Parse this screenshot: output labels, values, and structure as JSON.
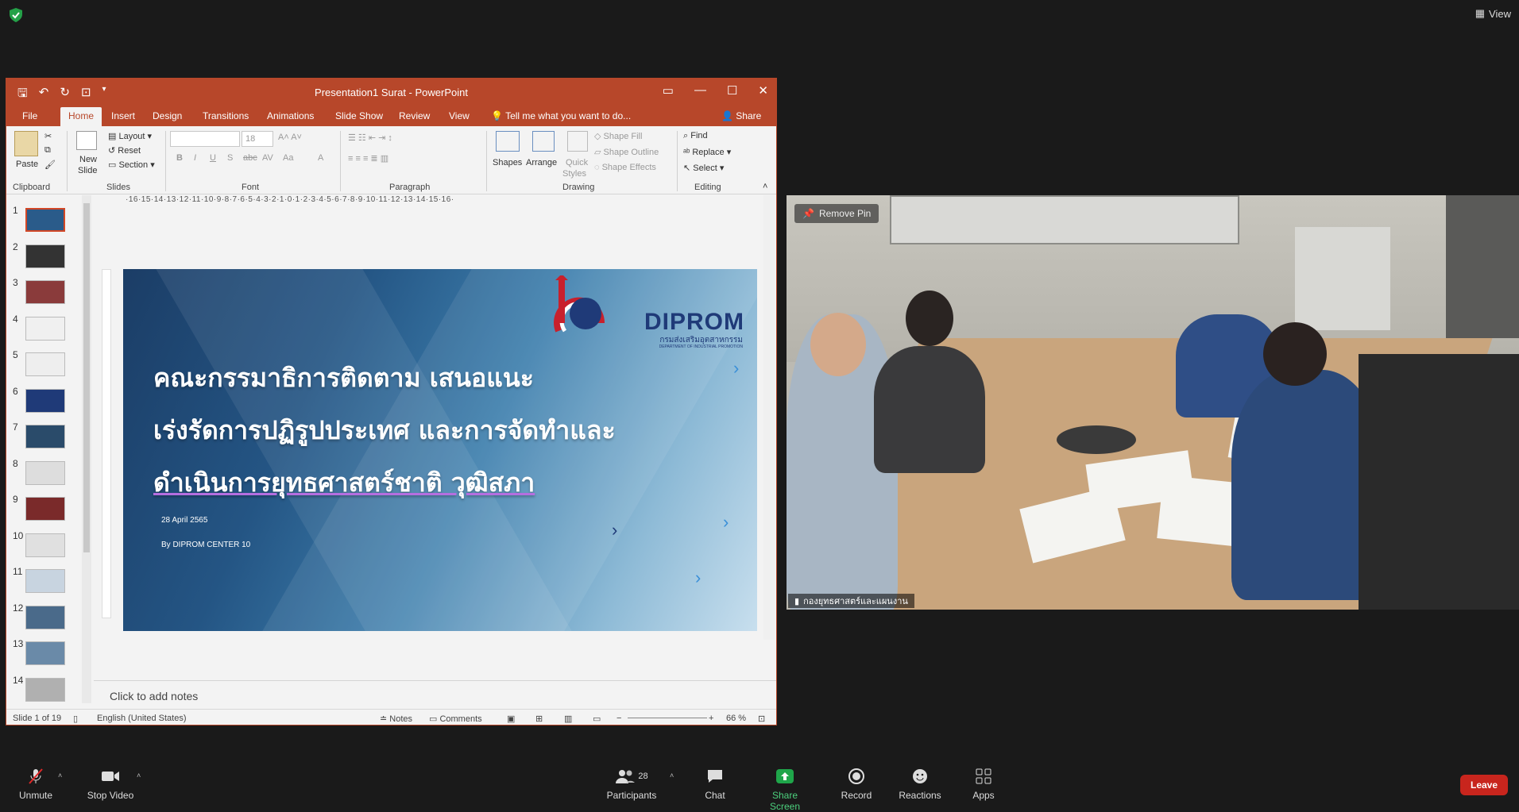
{
  "zoom": {
    "view_label": "View",
    "remove_pin_label": "Remove Pin",
    "participant_name": "กองยุทธศาสตร์และแผนงาน",
    "participants_count": "28",
    "toolbar": {
      "unmute": "Unmute",
      "stop_video": "Stop Video",
      "participants": "Participants",
      "chat": "Chat",
      "share_screen": "Share Screen",
      "record": "Record",
      "reactions": "Reactions",
      "apps": "Apps",
      "leave": "Leave"
    },
    "colors": {
      "share_green": "#1fa64a",
      "leave_red": "#c8251d"
    }
  },
  "ppt": {
    "title": "Presentation1 Surat - PowerPoint",
    "share": "Share",
    "tabs": [
      "File",
      "Home",
      "Insert",
      "Design",
      "Transitions",
      "Animations",
      "Slide Show",
      "Review",
      "View"
    ],
    "tell_me": "Tell me what you want to do...",
    "ribbon": {
      "paste": "Paste",
      "clipboard": "Clipboard",
      "new_slide": "New",
      "new_slide2": "Slide",
      "layout": "Layout",
      "reset": "Reset",
      "section": "Section",
      "slides": "Slides",
      "font_size": "18",
      "font": "Font",
      "paragraph": "Paragraph",
      "shapes": "Shapes",
      "arrange": "Arrange",
      "quick": "Quick",
      "styles": "Styles",
      "shape_fill": "Shape Fill",
      "shape_outline": "Shape Outline",
      "shape_effects": "Shape Effects",
      "drawing": "Drawing",
      "find": "Find",
      "replace": "Replace",
      "select": "Select",
      "editing": "Editing"
    },
    "ruler": "·16·15·14·13·12·11·10·9·8·7·6·5·4·3·2·1·0·1·2·3·4·5·6·7·8·9·10·11·12·13·14·15·16·",
    "thumb_numbers": [
      "1",
      "2",
      "3",
      "4",
      "5",
      "6",
      "7",
      "8",
      "9",
      "10",
      "11",
      "12",
      "13",
      "14"
    ],
    "slide": {
      "title_lines": [
        "คณะกรรมาธิการติดตาม เสนอแนะ",
        "เร่งรัดการปฏิรูปประเทศ และการจัดทำและ",
        "ดำเนินการยุทธศาสตร์ชาติ วุฒิสภา"
      ],
      "date": "28 April 2565",
      "by": "By DIPROM CENTER 10",
      "logo_name": "DIPROM",
      "logo_thai": "กรมส่งเสริมอุตสาหกรรม",
      "logo_eng": "DEPARTMENT OF INDUSTRIAL PROMOTION"
    },
    "notes_placeholder": "Click to add notes",
    "status": {
      "slide_of": "Slide 1 of 19",
      "language": "English (United States)",
      "notes": "Notes",
      "comments": "Comments",
      "zoom": "66 %"
    },
    "colors": {
      "accent": "#b7472a"
    }
  }
}
